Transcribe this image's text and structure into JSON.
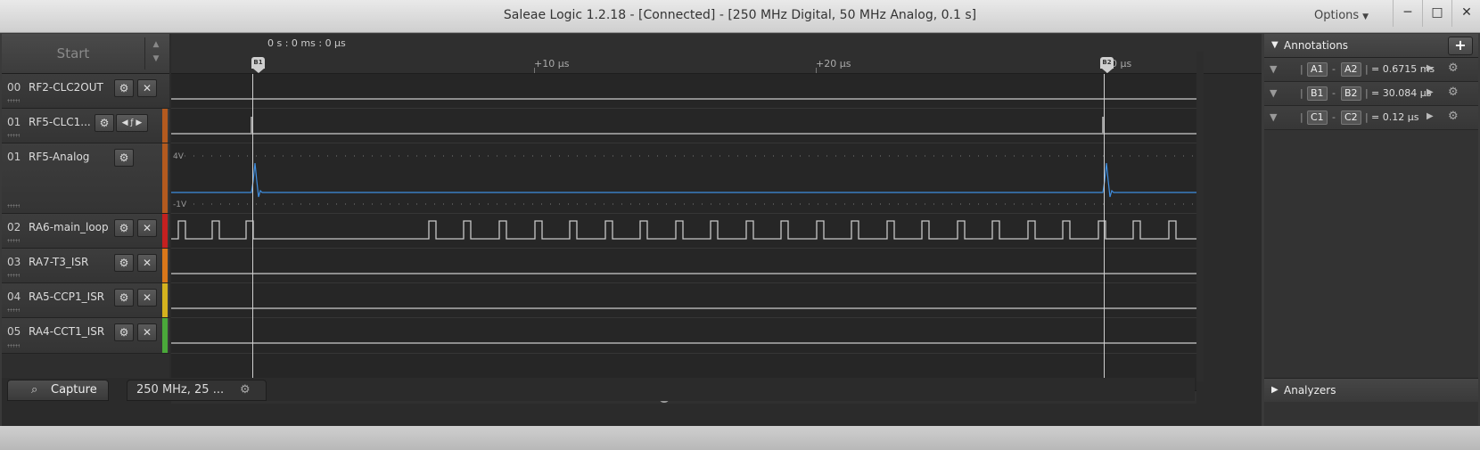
{
  "window": {
    "title": "Saleae Logic 1.2.18 - [Connected] - [250 MHz Digital, 50 MHz Analog, 0.1 s]",
    "options_label": "Options",
    "minimize_glyph": "─",
    "maximize_glyph": "□",
    "close_glyph": "✕"
  },
  "capture": {
    "start_label": "Start",
    "time_header": "0 s : 0 ms : 0 µs",
    "ticks": [
      "+10 µs",
      "+20 µs",
      "0 µs"
    ],
    "marker_b1": "B1",
    "marker_b2": "B2"
  },
  "channels": [
    {
      "num": "00",
      "name": "RF2-CLC2OUT",
      "color": "#6a6a6a"
    },
    {
      "num": "01",
      "name": "RF5-CLC1...",
      "color": "#b35a1f"
    },
    {
      "num": "01",
      "name": "RF5-Analog",
      "color": "#b35a1f",
      "analog_top_label": "4V",
      "analog_bottom_label": "-1V"
    },
    {
      "num": "02",
      "name": "RA6-main_loop",
      "color": "#c42020"
    },
    {
      "num": "03",
      "name": "RA7-T3_ISR",
      "color": "#d9771a"
    },
    {
      "num": "04",
      "name": "RA5-CCP1_ISR",
      "color": "#d4b21e"
    },
    {
      "num": "05",
      "name": "RA4-CCT1_ISR",
      "color": "#4aa83a"
    }
  ],
  "tabs": {
    "capture_label": "Capture",
    "settings_label": "250 MHz, 25 ..."
  },
  "annotations": {
    "header": "Annotations",
    "add_glyph": "+",
    "rows": [
      {
        "from": "A1",
        "to": "A2",
        "value": "= 0.6715 ms"
      },
      {
        "from": "B1",
        "to": "B2",
        "value": "= 30.084 µs"
      },
      {
        "from": "C1",
        "to": "C2",
        "value": "= 0.12 µs"
      }
    ]
  },
  "analyzers": {
    "header": "Analyzers"
  }
}
